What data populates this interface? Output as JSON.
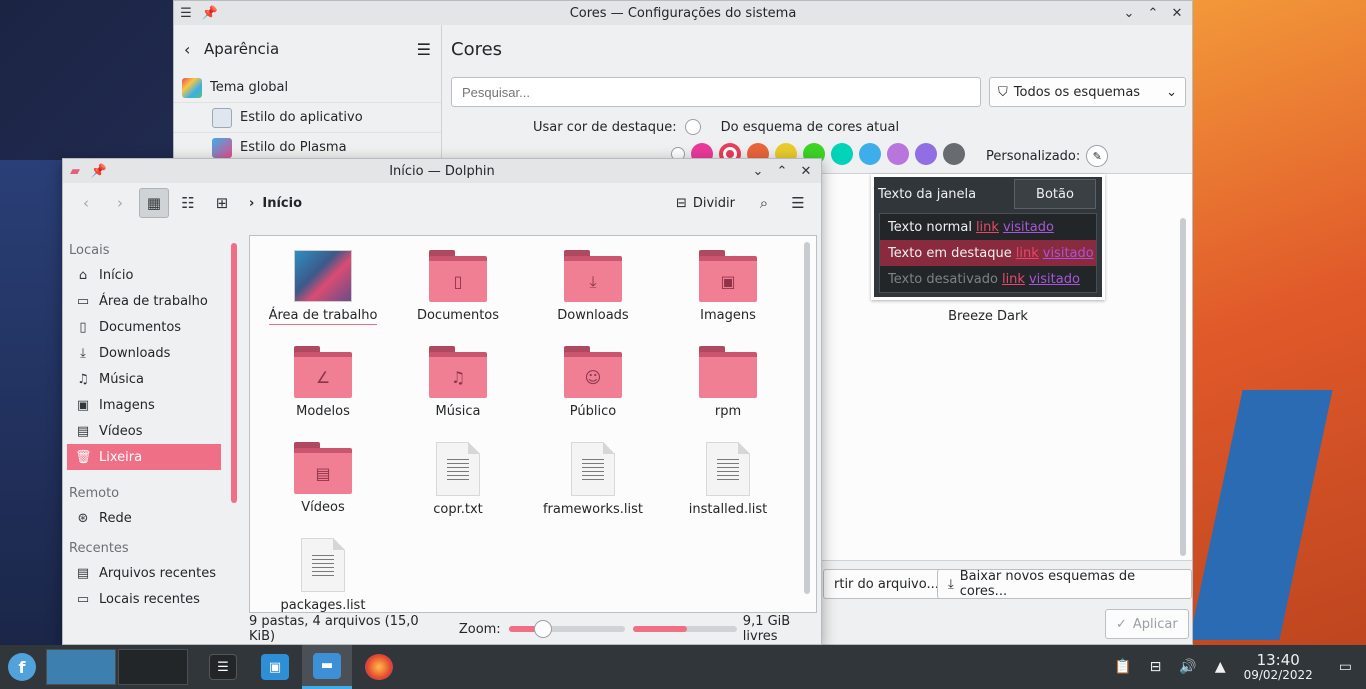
{
  "settings": {
    "title": "Cores — Configurações do sistema",
    "back_label": "Aparência",
    "nav": [
      "Tema global",
      "Estilo do aplicativo",
      "Estilo do Plasma"
    ],
    "heading": "Cores",
    "search_placeholder": "Pesquisar...",
    "filter": "Todos os esquemas",
    "accent_label": "Usar cor de destaque:",
    "accent_option": "Do esquema de cores atual",
    "custom_label": "Personalizado:",
    "swatch_colors": [
      "#e93a9a",
      "#e93d58",
      "#e9643a",
      "#e8cb2d",
      "#3dd425",
      "#00d3b8",
      "#3daee9",
      "#b875dc",
      "#926ee4",
      "#686b6f"
    ],
    "preview": {
      "window_text": "Texto da janela",
      "button": "Botão",
      "rows": [
        {
          "text": "Texto normal",
          "link": "link",
          "visited": "visitado"
        },
        {
          "text": "Texto em destaque",
          "link": "link",
          "visited": "visitado"
        },
        {
          "text": "Texto desativado",
          "link": "link",
          "visited": "visitado"
        }
      ],
      "scheme_name": "Breeze Dark"
    },
    "import_button": "rtir do arquivo...",
    "download_button": "Baixar novos esquemas de cores...",
    "apply_button": "Aplicar"
  },
  "dolphin": {
    "title": "Início — Dolphin",
    "breadcrumb": "Início",
    "split_label": "Dividir",
    "places": {
      "sections": [
        "Locais",
        "Remoto",
        "Recentes"
      ],
      "locais": [
        "Início",
        "Área de trabalho",
        "Documentos",
        "Downloads",
        "Música",
        "Imagens",
        "Vídeos",
        "Lixeira"
      ],
      "remoto": [
        "Rede"
      ],
      "recentes": [
        "Arquivos recentes",
        "Locais recentes"
      ]
    },
    "items": [
      "Área de trabalho",
      "Documentos",
      "Downloads",
      "Imagens",
      "Modelos",
      "Música",
      "Público",
      "rpm",
      "Vídeos",
      "copr.txt",
      "frameworks.list",
      "installed.list",
      "packages.list"
    ],
    "status": "9 pastas, 4 arquivos (15,0 KiB)",
    "zoom_label": "Zoom:",
    "zoom_level": 0.3,
    "free_space": "9,1 GiB livres",
    "disk_used_fraction": 0.52
  },
  "panel": {
    "time": "13:40",
    "date": "09/02/2022"
  }
}
